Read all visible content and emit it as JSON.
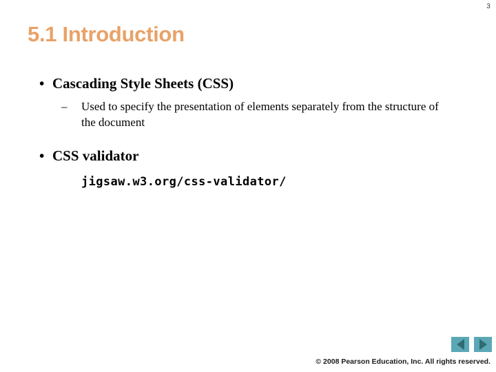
{
  "slide": {
    "page_number": "3",
    "title": "5.1 Introduction",
    "title_color": "#e8a268",
    "background_color": "#ffffff"
  },
  "outline": {
    "bullet_marker": "•",
    "dash_marker": "–",
    "items": [
      {
        "level": 1,
        "text": "Cascading Style Sheets (CSS)"
      },
      {
        "level": 2,
        "text": "Used to specify the presentation of elements separately from the structure of the document"
      },
      {
        "level": 1,
        "text": "CSS validator"
      }
    ],
    "url": "jigsaw.w3.org/css-validator/"
  },
  "navigation": {
    "previous_label": "◀",
    "next_label": "▶",
    "button_color": "#5ba8b5",
    "arrow_color": "#2f6b75"
  },
  "footer": {
    "copyright": "© 2008 Pearson Education, Inc.  All rights reserved."
  }
}
